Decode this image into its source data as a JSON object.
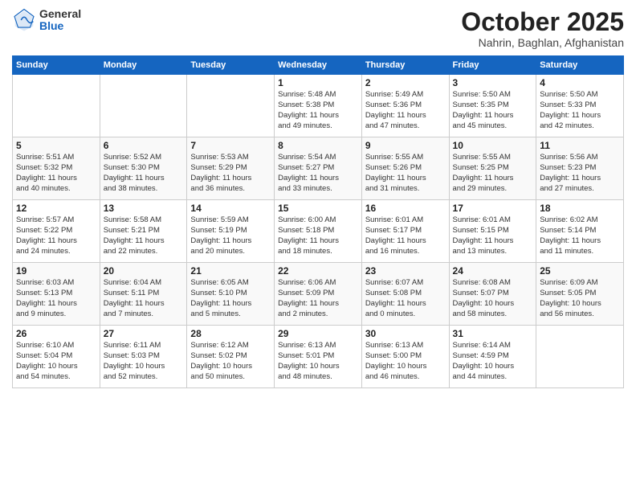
{
  "logo": {
    "general": "General",
    "blue": "Blue"
  },
  "title": "October 2025",
  "location": "Nahrin, Baghlan, Afghanistan",
  "days_of_week": [
    "Sunday",
    "Monday",
    "Tuesday",
    "Wednesday",
    "Thursday",
    "Friday",
    "Saturday"
  ],
  "weeks": [
    [
      {
        "day": "",
        "info": ""
      },
      {
        "day": "",
        "info": ""
      },
      {
        "day": "",
        "info": ""
      },
      {
        "day": "1",
        "info": "Sunrise: 5:48 AM\nSunset: 5:38 PM\nDaylight: 11 hours\nand 49 minutes."
      },
      {
        "day": "2",
        "info": "Sunrise: 5:49 AM\nSunset: 5:36 PM\nDaylight: 11 hours\nand 47 minutes."
      },
      {
        "day": "3",
        "info": "Sunrise: 5:50 AM\nSunset: 5:35 PM\nDaylight: 11 hours\nand 45 minutes."
      },
      {
        "day": "4",
        "info": "Sunrise: 5:50 AM\nSunset: 5:33 PM\nDaylight: 11 hours\nand 42 minutes."
      }
    ],
    [
      {
        "day": "5",
        "info": "Sunrise: 5:51 AM\nSunset: 5:32 PM\nDaylight: 11 hours\nand 40 minutes."
      },
      {
        "day": "6",
        "info": "Sunrise: 5:52 AM\nSunset: 5:30 PM\nDaylight: 11 hours\nand 38 minutes."
      },
      {
        "day": "7",
        "info": "Sunrise: 5:53 AM\nSunset: 5:29 PM\nDaylight: 11 hours\nand 36 minutes."
      },
      {
        "day": "8",
        "info": "Sunrise: 5:54 AM\nSunset: 5:27 PM\nDaylight: 11 hours\nand 33 minutes."
      },
      {
        "day": "9",
        "info": "Sunrise: 5:55 AM\nSunset: 5:26 PM\nDaylight: 11 hours\nand 31 minutes."
      },
      {
        "day": "10",
        "info": "Sunrise: 5:55 AM\nSunset: 5:25 PM\nDaylight: 11 hours\nand 29 minutes."
      },
      {
        "day": "11",
        "info": "Sunrise: 5:56 AM\nSunset: 5:23 PM\nDaylight: 11 hours\nand 27 minutes."
      }
    ],
    [
      {
        "day": "12",
        "info": "Sunrise: 5:57 AM\nSunset: 5:22 PM\nDaylight: 11 hours\nand 24 minutes."
      },
      {
        "day": "13",
        "info": "Sunrise: 5:58 AM\nSunset: 5:21 PM\nDaylight: 11 hours\nand 22 minutes."
      },
      {
        "day": "14",
        "info": "Sunrise: 5:59 AM\nSunset: 5:19 PM\nDaylight: 11 hours\nand 20 minutes."
      },
      {
        "day": "15",
        "info": "Sunrise: 6:00 AM\nSunset: 5:18 PM\nDaylight: 11 hours\nand 18 minutes."
      },
      {
        "day": "16",
        "info": "Sunrise: 6:01 AM\nSunset: 5:17 PM\nDaylight: 11 hours\nand 16 minutes."
      },
      {
        "day": "17",
        "info": "Sunrise: 6:01 AM\nSunset: 5:15 PM\nDaylight: 11 hours\nand 13 minutes."
      },
      {
        "day": "18",
        "info": "Sunrise: 6:02 AM\nSunset: 5:14 PM\nDaylight: 11 hours\nand 11 minutes."
      }
    ],
    [
      {
        "day": "19",
        "info": "Sunrise: 6:03 AM\nSunset: 5:13 PM\nDaylight: 11 hours\nand 9 minutes."
      },
      {
        "day": "20",
        "info": "Sunrise: 6:04 AM\nSunset: 5:11 PM\nDaylight: 11 hours\nand 7 minutes."
      },
      {
        "day": "21",
        "info": "Sunrise: 6:05 AM\nSunset: 5:10 PM\nDaylight: 11 hours\nand 5 minutes."
      },
      {
        "day": "22",
        "info": "Sunrise: 6:06 AM\nSunset: 5:09 PM\nDaylight: 11 hours\nand 2 minutes."
      },
      {
        "day": "23",
        "info": "Sunrise: 6:07 AM\nSunset: 5:08 PM\nDaylight: 11 hours\nand 0 minutes."
      },
      {
        "day": "24",
        "info": "Sunrise: 6:08 AM\nSunset: 5:07 PM\nDaylight: 10 hours\nand 58 minutes."
      },
      {
        "day": "25",
        "info": "Sunrise: 6:09 AM\nSunset: 5:05 PM\nDaylight: 10 hours\nand 56 minutes."
      }
    ],
    [
      {
        "day": "26",
        "info": "Sunrise: 6:10 AM\nSunset: 5:04 PM\nDaylight: 10 hours\nand 54 minutes."
      },
      {
        "day": "27",
        "info": "Sunrise: 6:11 AM\nSunset: 5:03 PM\nDaylight: 10 hours\nand 52 minutes."
      },
      {
        "day": "28",
        "info": "Sunrise: 6:12 AM\nSunset: 5:02 PM\nDaylight: 10 hours\nand 50 minutes."
      },
      {
        "day": "29",
        "info": "Sunrise: 6:13 AM\nSunset: 5:01 PM\nDaylight: 10 hours\nand 48 minutes."
      },
      {
        "day": "30",
        "info": "Sunrise: 6:13 AM\nSunset: 5:00 PM\nDaylight: 10 hours\nand 46 minutes."
      },
      {
        "day": "31",
        "info": "Sunrise: 6:14 AM\nSunset: 4:59 PM\nDaylight: 10 hours\nand 44 minutes."
      },
      {
        "day": "",
        "info": ""
      }
    ]
  ]
}
